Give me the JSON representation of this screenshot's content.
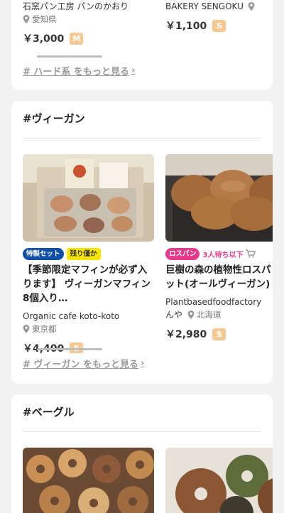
{
  "hard_section": {
    "item1": {
      "shop": "石窯パン工房 パンのかおり",
      "location": "愛知県",
      "price": "￥3,000",
      "size": "M"
    },
    "item2": {
      "shop": "BAKERY SENGOKU",
      "price": "￥1,100",
      "size": "S"
    },
    "more_link": "# ハード系 をもっと見る"
  },
  "vegan_section": {
    "title": "#ヴィーガン",
    "item1": {
      "tags": [
        "特製セット",
        "残り僅か"
      ],
      "title": "【季節限定マフィンが必ず入ります】 ヴィーガンマフィン 8個入り…",
      "shop": "Organic cafe koto-koto",
      "location": "東京都",
      "price": "￥4,400",
      "size": "S"
    },
    "item2": {
      "tags": [
        "ロスパン",
        "3人待ち以下"
      ],
      "title": "巨樹の森の植物性ロスパンセット(オールヴィーガン)",
      "shop": "Plantbasedfoodfactory",
      "shop_suffix": "んや",
      "location": "北海道",
      "price": "￥2,980",
      "size": "S"
    },
    "more_link": "# ヴィーガン をもっと見る"
  },
  "bagel_section": {
    "title": "#ベーグル"
  },
  "colors": {
    "pink": "#e8388a",
    "blue": "#0f4fa8",
    "yellow": "#f7e400",
    "badge": "#f5c894"
  }
}
